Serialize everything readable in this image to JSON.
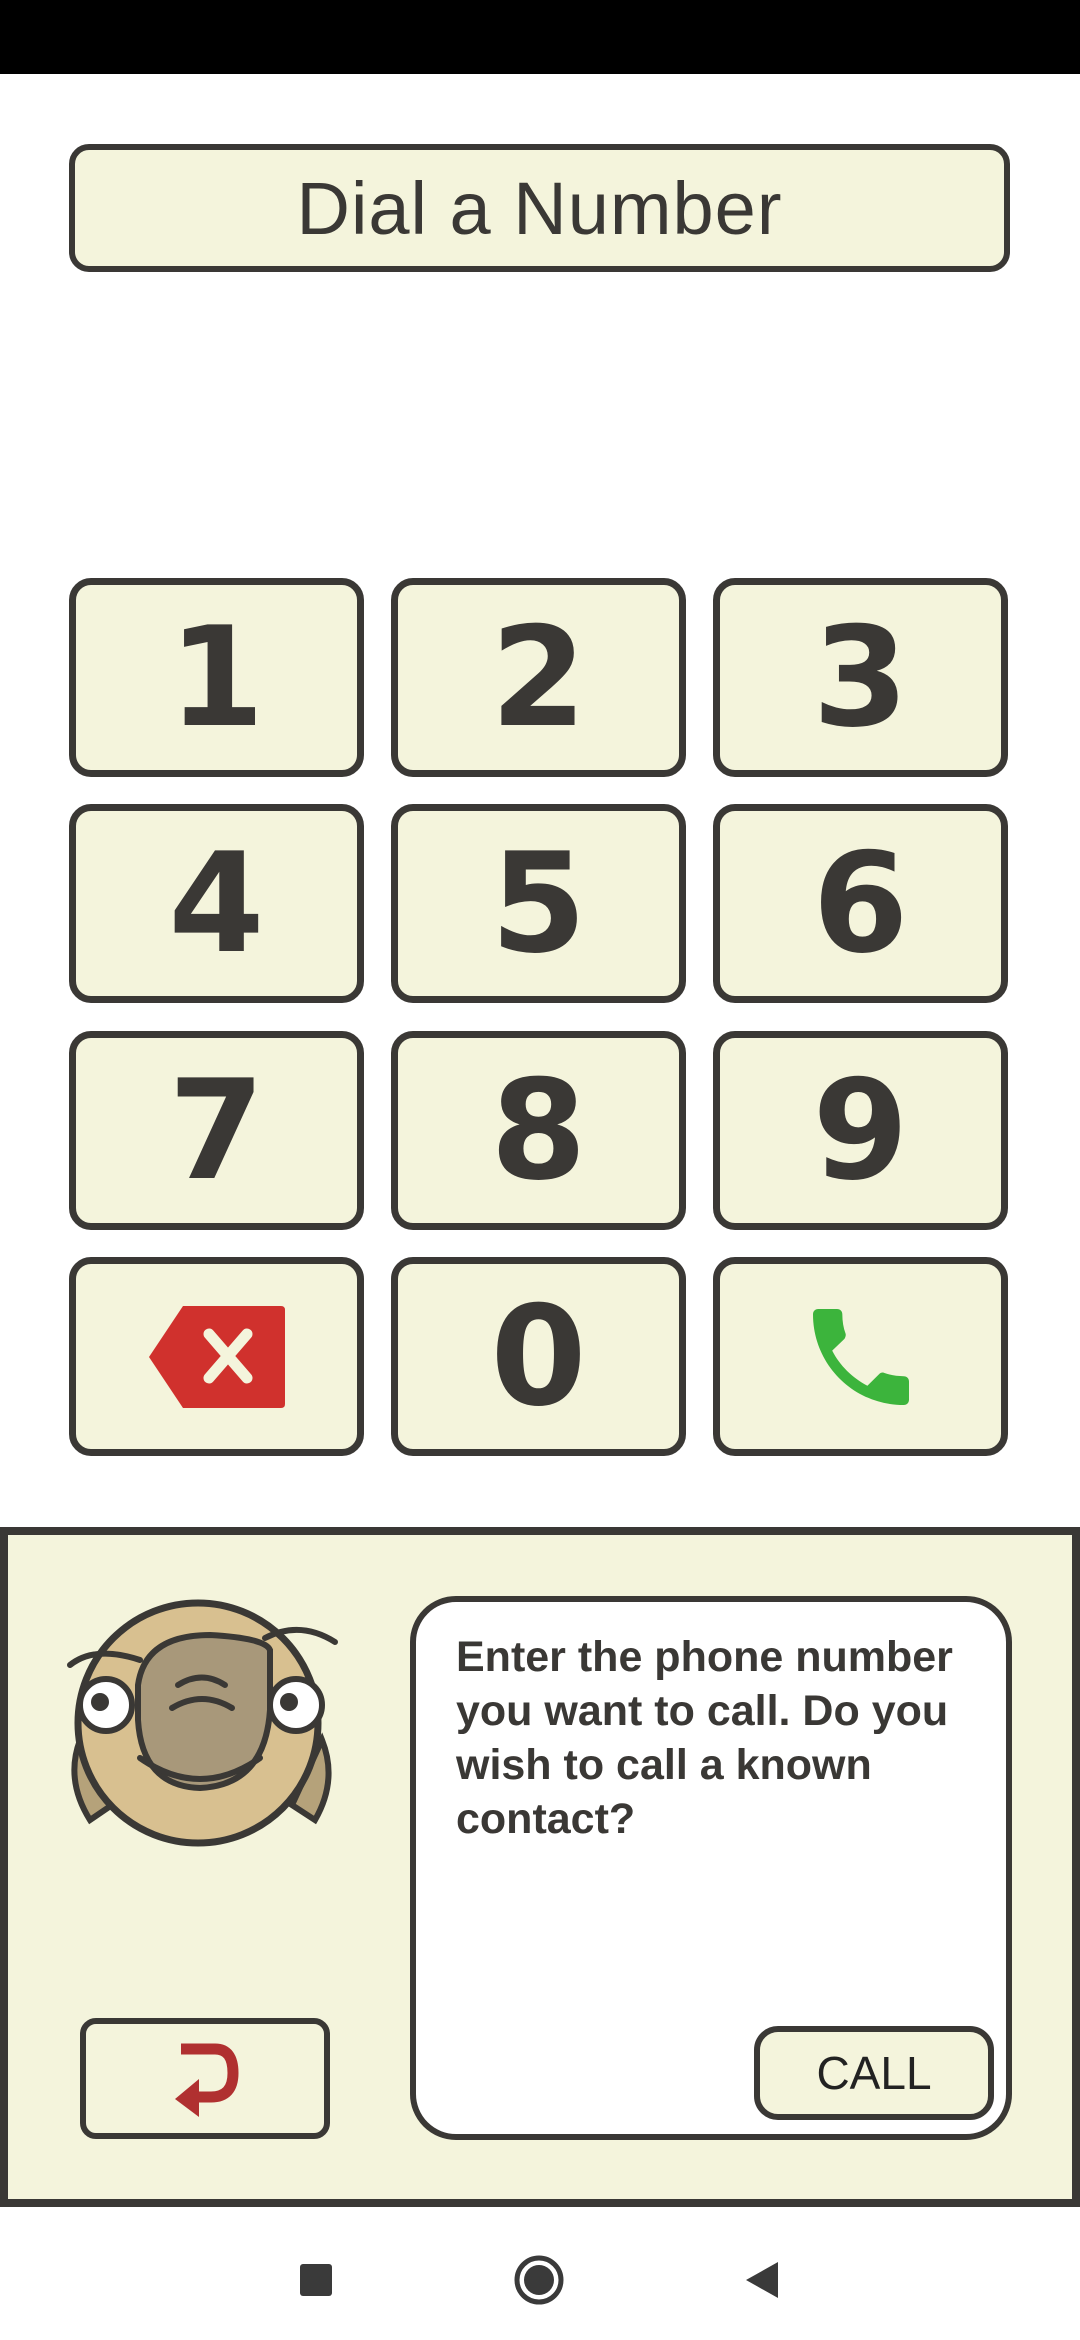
{
  "header": {
    "title": "Dial a Number"
  },
  "keypad": {
    "keys": [
      "1",
      "2",
      "3",
      "4",
      "5",
      "6",
      "7",
      "8",
      "9",
      "0"
    ],
    "delete_icon": "backspace-x-icon",
    "call_icon": "phone-handset-icon",
    "colors": {
      "delete": "#d0312d",
      "call": "#3cb43c",
      "key_bg": "#f4f4dc",
      "border": "#3a3835"
    }
  },
  "assistant": {
    "mascot_icon": "sloth-mascot-icon",
    "message": "Enter the phone number you want to call. Do you wish to call a known contact?",
    "call_label": "CALL",
    "back_icon": "return-arrow-icon"
  },
  "navigation": {
    "recents_icon": "square-icon",
    "home_icon": "circle-icon",
    "back_icon": "triangle-back-icon"
  }
}
